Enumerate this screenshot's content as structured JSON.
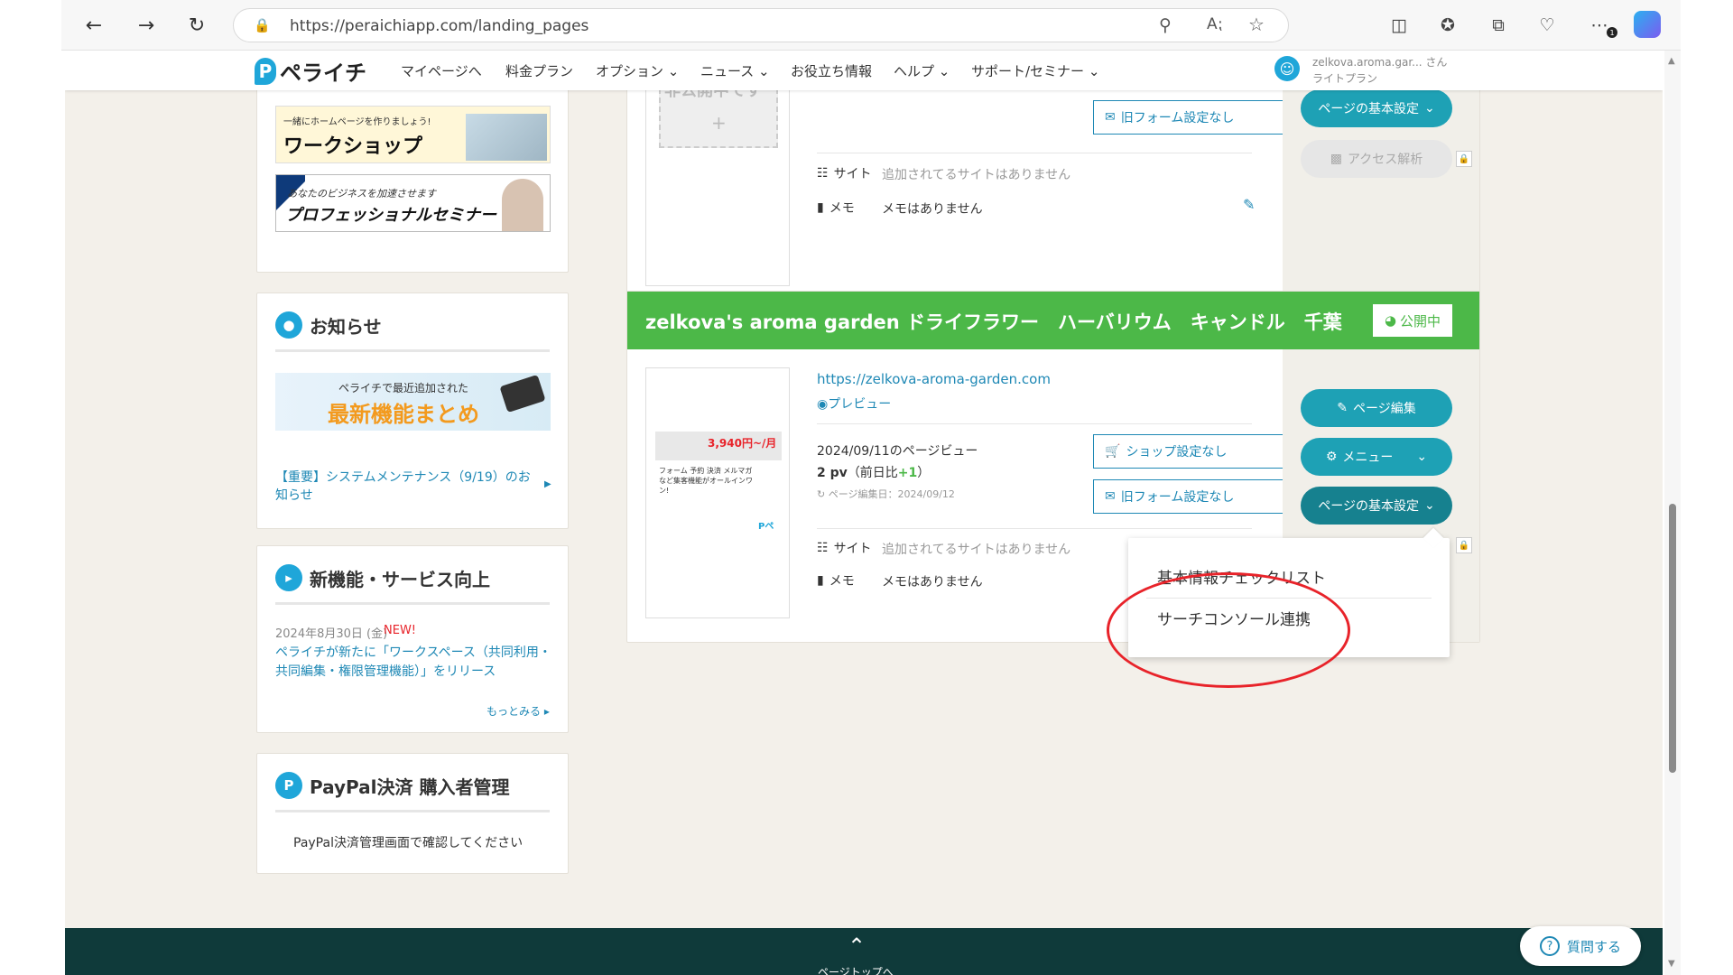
{
  "browser": {
    "url": "https://peraichiapp.com/landing_pages",
    "notification_badge": "1"
  },
  "header": {
    "logo_text": "ペライチ",
    "nav": [
      "マイページへ",
      "料金プラン",
      "オプション",
      "ニュース",
      "お役立ち情報",
      "ヘルプ",
      "サポート/セミナー"
    ],
    "user_name": "zelkova.aroma.gar... さん",
    "user_plan": "ライトプラン"
  },
  "sidebar": {
    "workshop": {
      "small": "一緒にホームページを作りましょう!",
      "big": "ワークショップ"
    },
    "seminar": {
      "small": "あなたのビジネスを加速させます",
      "big": "プロフェッショナルセミナー"
    },
    "news": {
      "title": "お知らせ",
      "banner_small": "ペライチで最近追加された",
      "banner_big": "最新機能まとめ",
      "link": "【重要】システムメンテナンス（9/19）のお知らせ"
    },
    "features": {
      "title": "新機能・サービス向上",
      "date": "2024年8月30日 (金)",
      "new": "NEW!",
      "text": "ペライチが新たに「ワークスペース（共同利用・共同編集・権限管理機能）」をリリース",
      "more": "もっとみる"
    },
    "paypal": {
      "title": "PayPal決済 購入者管理",
      "text": "PayPal決済管理画面で確認してください"
    }
  },
  "page1": {
    "thumb_text": "非公開中です",
    "form_btn": "旧フォーム設定なし",
    "site_label": "サイト",
    "site_value": "追加されてるサイトはありません",
    "memo_label": "メモ",
    "memo_value": "メモはありません",
    "basic_btn": "ページの基本設定",
    "access_btn": "アクセス解析"
  },
  "page2": {
    "title": "zelkova's aroma garden ドライフラワー　ハーバリウム　キャンドル　千葉",
    "status": "公開中",
    "url": "https://zelkova-aroma-garden.com",
    "preview": "プレビュー",
    "pv_label": "2024/09/11のページビュー",
    "pv_value": "2 pv",
    "pv_diff_prefix": "（前日比",
    "pv_diff": "+1",
    "pv_diff_suffix": "）",
    "edited": "ページ編集日：2024/09/12",
    "shop_btn": "ショップ設定なし",
    "form_btn": "旧フォーム設定なし",
    "site_label": "サイト",
    "site_value": "追加されてるサイトはありません",
    "memo_label": "メモ",
    "memo_value": "メモはありません",
    "edit_btn": "ページ編集",
    "menu_btn": "メニュー",
    "basic_btn": "ページの基本設定",
    "thumb_price": "3,940円~/月",
    "thumb_text": "フォーム 予約 決済 メルマガなど集客機能がオールインワン!"
  },
  "dropdown": {
    "items": [
      "基本情報チェックリスト",
      "サーチコンソール連携"
    ]
  },
  "footer": {
    "pagetop": "ページトップへ",
    "help": "質問する"
  },
  "colors": {
    "accent": "#1ea1b5",
    "green_header": "#4cb848",
    "link": "#1e88b5",
    "annotation": "#e8232a"
  }
}
